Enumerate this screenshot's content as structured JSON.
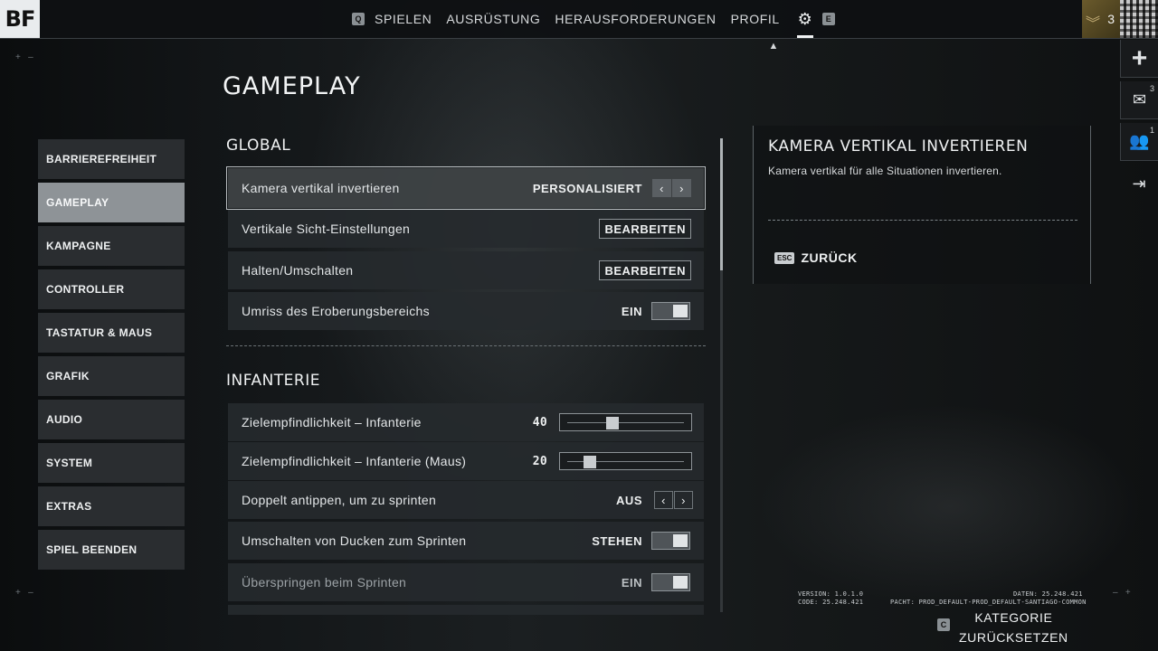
{
  "topbar": {
    "logo": "BF",
    "nav_left_key": "Q",
    "nav_right_key": "E",
    "nav": [
      "SPIELEN",
      "AUSRÜSTUNG",
      "HERAUSFORDERUNGEN",
      "PROFIL"
    ],
    "gear_icon": "settings-gear-icon",
    "rank_level": "3"
  },
  "side_icons": {
    "mail_count": "3",
    "squad_count": "1"
  },
  "page_title": "GAMEPLAY",
  "menu": [
    {
      "label": "BARRIEREFREIHEIT"
    },
    {
      "label": "GAMEPLAY",
      "active": true
    },
    {
      "label": "KAMPAGNE"
    },
    {
      "label": "CONTROLLER"
    },
    {
      "label": "TASTATUR & MAUS"
    },
    {
      "label": "GRAFIK"
    },
    {
      "label": "AUDIO"
    },
    {
      "label": "SYSTEM"
    },
    {
      "label": "EXTRAS"
    },
    {
      "label": "SPIEL BEENDEN"
    }
  ],
  "sections": {
    "global": "GLOBAL",
    "infanterie": "INFANTERIE"
  },
  "settings": {
    "kamera": {
      "label": "Kamera vertikal invertieren",
      "value": "PERSONALISIERT"
    },
    "vertikale": {
      "label": "Vertikale Sicht-Einstellungen",
      "button": "BEARBEITEN"
    },
    "halten": {
      "label": "Halten/Umschalten",
      "button": "BEARBEITEN"
    },
    "umriss": {
      "label": "Umriss des Eroberungsbereichs",
      "value": "EIN"
    },
    "ziel": {
      "label": "Zielempfindlichkeit – Infanterie",
      "value": "40"
    },
    "ziel_maus": {
      "label": "Zielempfindlichkeit – Infanterie (Maus)",
      "value": "20"
    },
    "doppelt": {
      "label": "Doppelt antippen, um zu sprinten",
      "value": "AUS"
    },
    "ducken": {
      "label": "Umschalten von Ducken zum Sprinten",
      "value": "STEHEN"
    },
    "ueberspringen": {
      "label": "Überspringen beim Sprinten",
      "value": "EIN"
    }
  },
  "description": {
    "title": "KAMERA VERTIKAL INVERTIEREN",
    "text": "Kamera vertikal für alle Situationen invertieren.",
    "esc_key": "ESC",
    "back_label": "ZURÜCK"
  },
  "footer": {
    "version": "VERSION: 1.0.1.0",
    "code": "CODE: 25.248.421",
    "daten": "DATEN: 25.248.421",
    "pacht": "PACHT: PROD_DEFAULT-PROD_DEFAULT-SANTIAGO-COMMON",
    "reset_key": "C",
    "reset_line1": "KATEGORIE",
    "reset_line2": "ZURÜCKSETZEN"
  }
}
